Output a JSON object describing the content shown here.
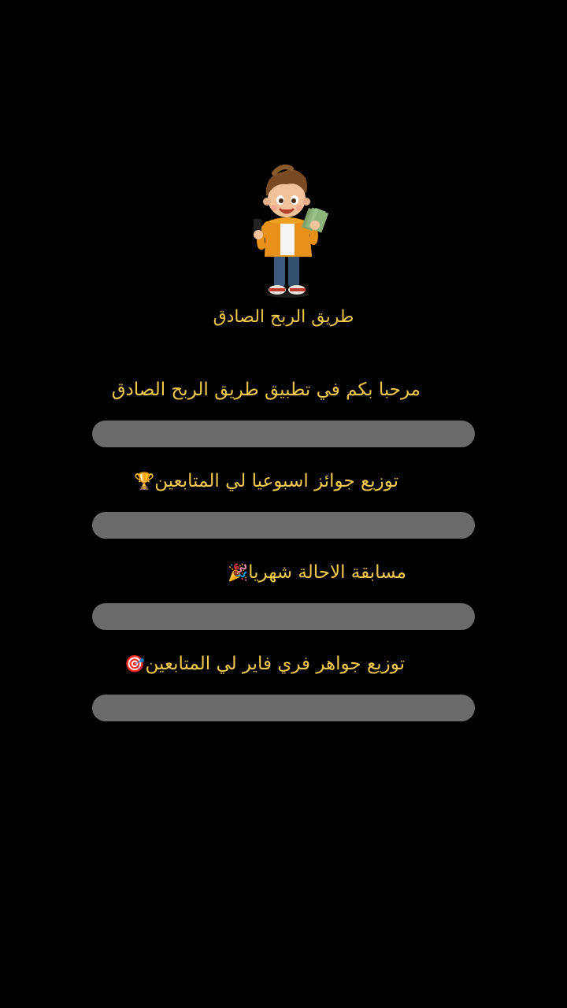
{
  "app_title": "طريق الربح الصادق",
  "mascot_icon": "boy-with-money-mascot-icon",
  "colors": {
    "background": "#000000",
    "text": "#f2c94c",
    "bar": "#6b6b6b"
  },
  "items": [
    {
      "text": "مرحبا بكم في تطبيق طريق الربح الصادق",
      "emoji": ""
    },
    {
      "text": "توزيع جوائز اسبوعيا لي المتابعين",
      "emoji": "🏆"
    },
    {
      "text": "مسابقة الاحالة شهريا",
      "emoji": "🎉"
    },
    {
      "text": "توزيع جواهر فري فاير لي المتابعين",
      "emoji": "🎯"
    }
  ]
}
